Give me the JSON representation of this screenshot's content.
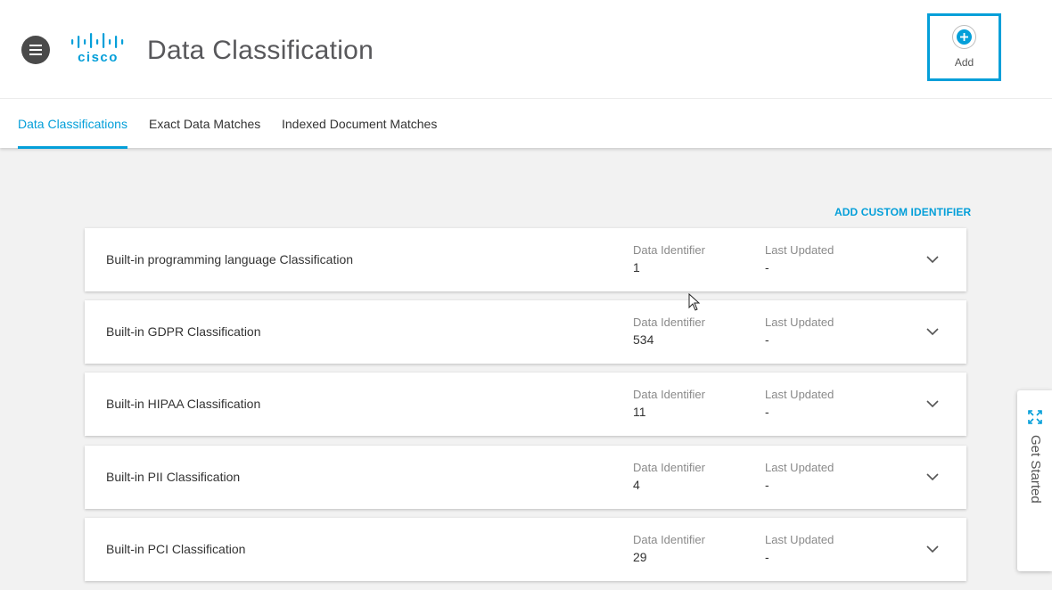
{
  "header": {
    "title": "Data Classification",
    "logo_text": "cisco",
    "add_label": "Add"
  },
  "tabs": [
    {
      "label": "Data Classifications",
      "active": true
    },
    {
      "label": "Exact Data Matches",
      "active": false
    },
    {
      "label": "Indexed Document Matches",
      "active": false
    }
  ],
  "add_custom_label": "ADD CUSTOM IDENTIFIER",
  "columns": {
    "data_identifier": "Data Identifier",
    "last_updated": "Last Updated"
  },
  "classifications": [
    {
      "name": "Built-in programming language Classification",
      "data_identifier": "1",
      "last_updated": "-"
    },
    {
      "name": "Built-in GDPR Classification",
      "data_identifier": "534",
      "last_updated": "-"
    },
    {
      "name": "Built-in HIPAA Classification",
      "data_identifier": "11",
      "last_updated": "-"
    },
    {
      "name": "Built-in PII Classification",
      "data_identifier": "4",
      "last_updated": "-"
    },
    {
      "name": "Built-in PCI Classification",
      "data_identifier": "29",
      "last_updated": "-"
    }
  ],
  "get_started_label": "Get Started",
  "icons": {
    "menu": "hamburger-icon",
    "add": "plus-circle-icon",
    "expand": "chevron-down-icon",
    "get_started": "expand-arrows-icon"
  },
  "colors": {
    "accent": "#049fd9",
    "title": "#58585b",
    "background": "#f2f2f2"
  }
}
